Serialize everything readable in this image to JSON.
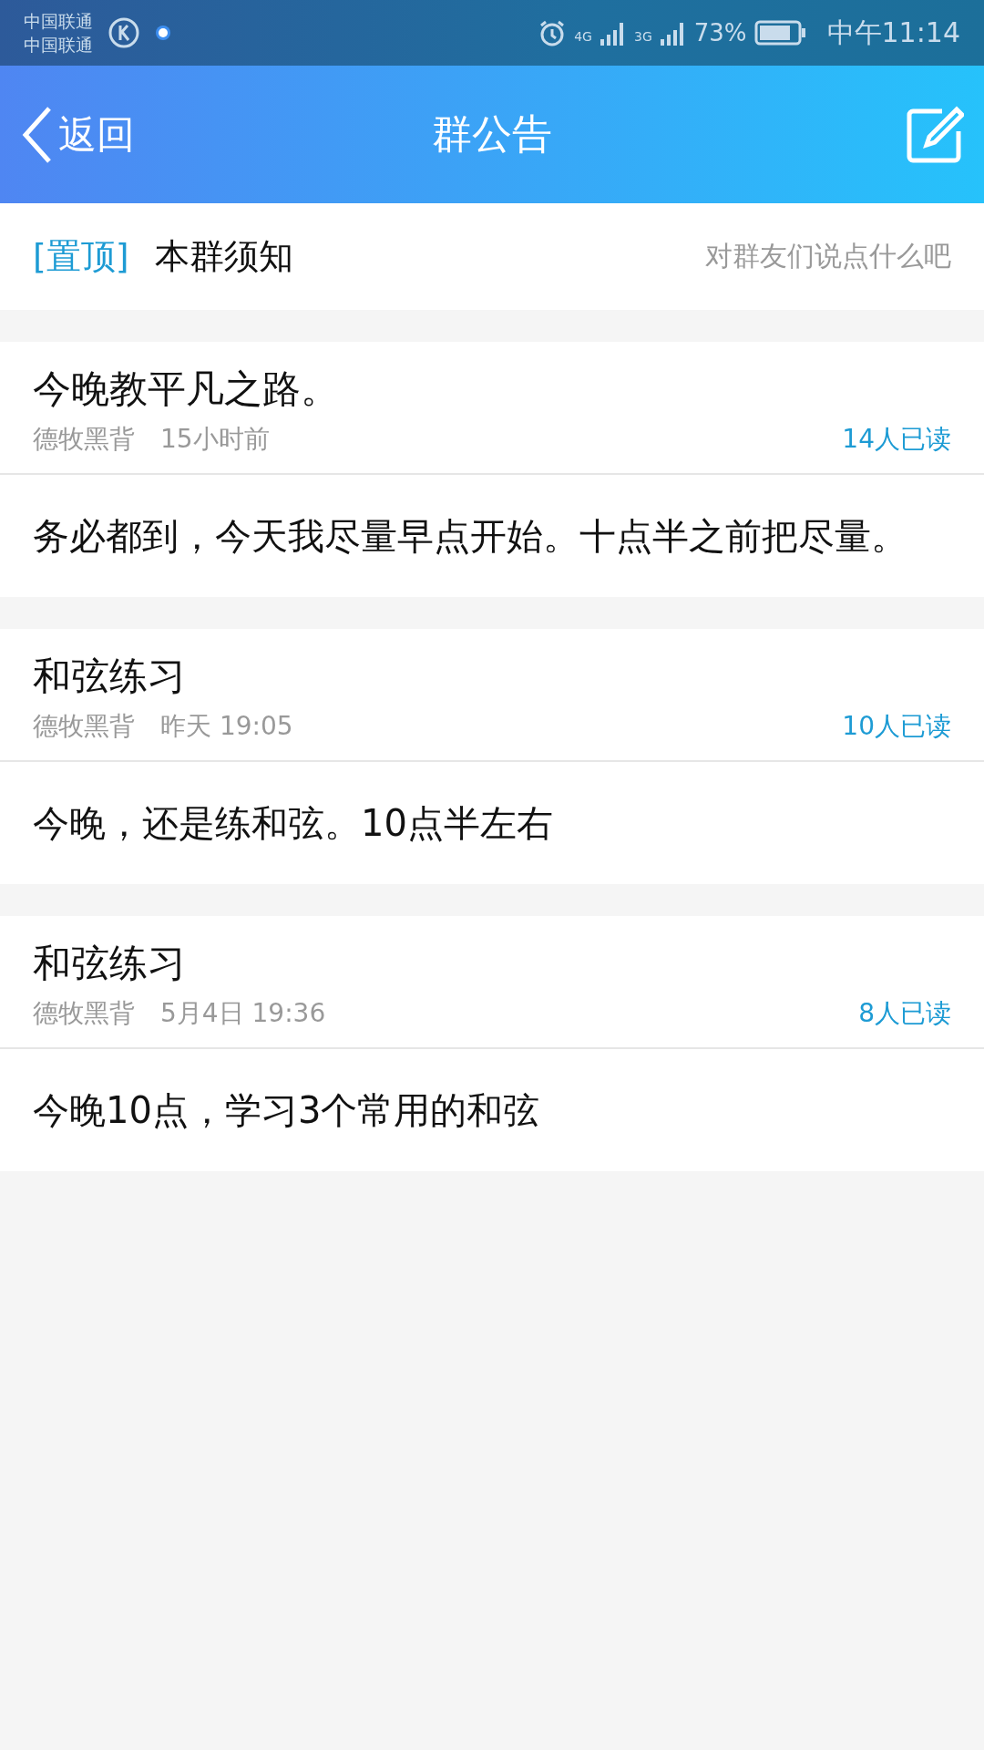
{
  "status_bar": {
    "carriers": [
      "中国联通",
      "中国联通"
    ],
    "network_1": "4G",
    "network_2": "3G",
    "battery": "73%",
    "time": "中午11:14"
  },
  "header": {
    "back": "返回",
    "title": "群公告"
  },
  "pinned": {
    "tag": "[置顶]",
    "title": "本群须知",
    "hint": "对群友们说点什么吧"
  },
  "notices": [
    {
      "title": "今晚教平凡之路。",
      "author": "德牧黑背",
      "time": "15小时前",
      "reads": "14人已读",
      "body": "务必都到，今天我尽量早点开始。十点半之前把尽量。"
    },
    {
      "title": "和弦练习",
      "author": "德牧黑背",
      "time": "昨天 19:05",
      "reads": "10人已读",
      "body": "今晚，还是练和弦。10点半左右"
    },
    {
      "title": "和弦练习",
      "author": "德牧黑背",
      "time": "5月4日 19:36",
      "reads": "8人已读",
      "body": "今晚10点，学习3个常用的和弦"
    }
  ]
}
